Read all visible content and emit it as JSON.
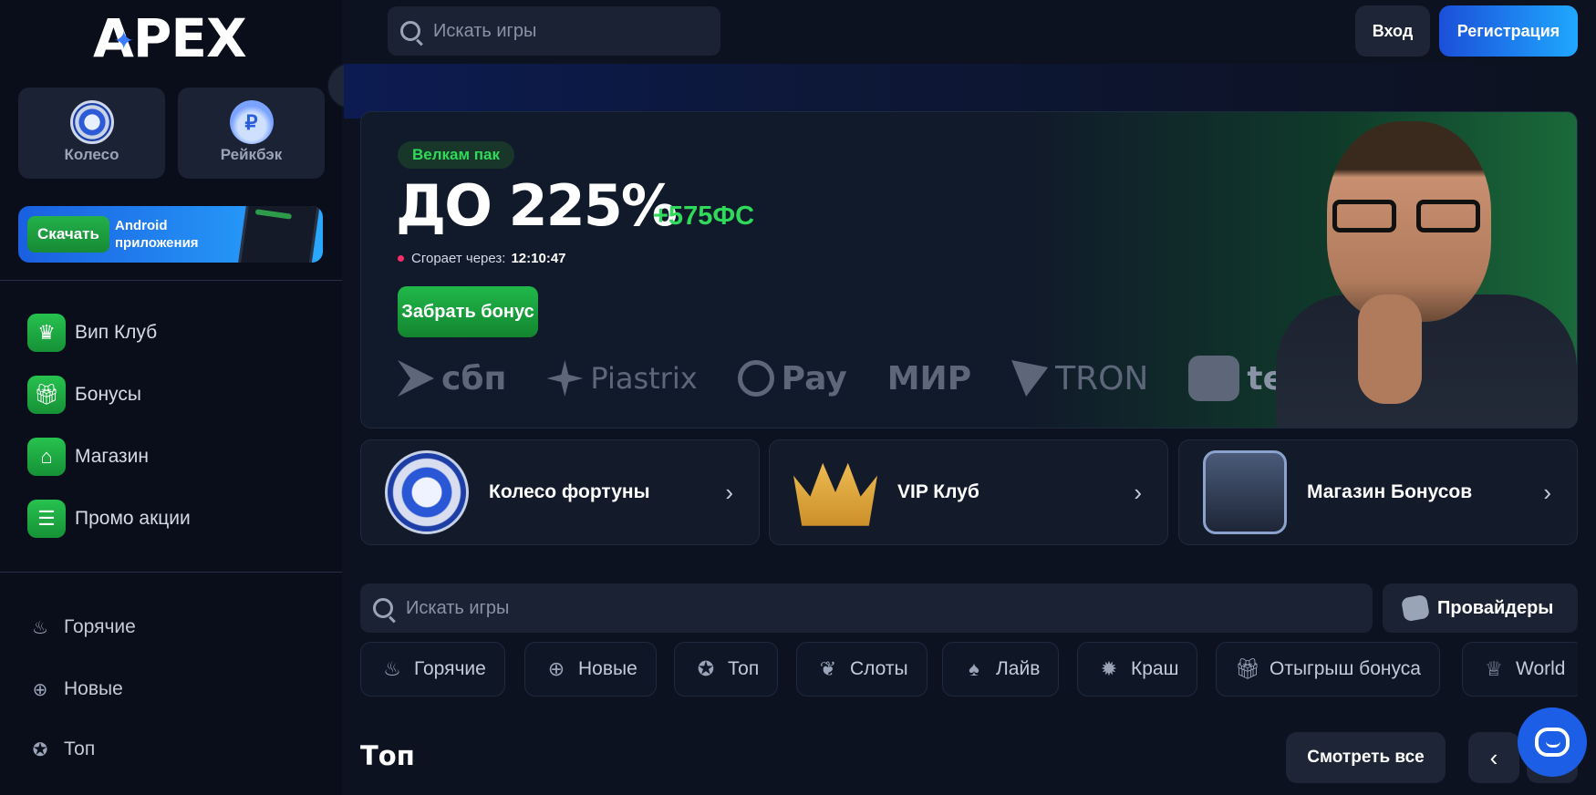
{
  "brand": {
    "logo_text": "APEX"
  },
  "sidebar": {
    "quick_cards": [
      {
        "label": "Колесо",
        "icon": "wheel-icon"
      },
      {
        "label": "Рейкбэк",
        "icon": "money-bag-icon"
      }
    ],
    "download": {
      "button_label": "Скачать",
      "line1": "Android",
      "line2": "приложения"
    },
    "menu": [
      {
        "label": "Вип Клуб",
        "icon": "crown-icon"
      },
      {
        "label": "Бонусы",
        "icon": "gift-icon"
      },
      {
        "label": "Магазин",
        "icon": "store-icon"
      },
      {
        "label": "Промо акции",
        "icon": "ticket-icon"
      }
    ],
    "categories": [
      {
        "label": "Горячие",
        "icon": "fire-icon"
      },
      {
        "label": "Новые",
        "icon": "plus-icon"
      },
      {
        "label": "Топ",
        "icon": "medal-icon"
      }
    ]
  },
  "header": {
    "search_placeholder": "Искать игры",
    "login_label": "Вход",
    "register_label": "Регистрация"
  },
  "banner": {
    "tag": "Велкам пак",
    "headline": "ДО 225%",
    "free_spins": "+575ФС",
    "expires_label": "Сгорает через:",
    "expires_time": "12:10:47",
    "cta_label": "Забрать бонус",
    "payment_logos": [
      "сбп",
      "Piastrix",
      "Pay",
      "МИР",
      "TRON",
      "tether"
    ]
  },
  "features": [
    {
      "label": "Колесо фортуны"
    },
    {
      "label": "VIP Клуб"
    },
    {
      "label": "Магазин Бонусов"
    }
  ],
  "games": {
    "search_placeholder": "Искать игры",
    "providers_label": "Провайдеры",
    "categories": [
      {
        "label": "Горячие",
        "icon": "fire-icon"
      },
      {
        "label": "Новые",
        "icon": "plus-icon"
      },
      {
        "label": "Топ",
        "icon": "medal-icon"
      },
      {
        "label": "Слоты",
        "icon": "cherry-icon"
      },
      {
        "label": "Лайв",
        "icon": "card-icon"
      },
      {
        "label": "Краш",
        "icon": "burst-icon"
      },
      {
        "label": "Отыгрыш бонуса",
        "icon": "gift-icon"
      },
      {
        "label": "World",
        "icon": "trophy-icon"
      }
    ]
  },
  "section": {
    "title": "Топ",
    "see_all_label": "Смотреть все"
  }
}
